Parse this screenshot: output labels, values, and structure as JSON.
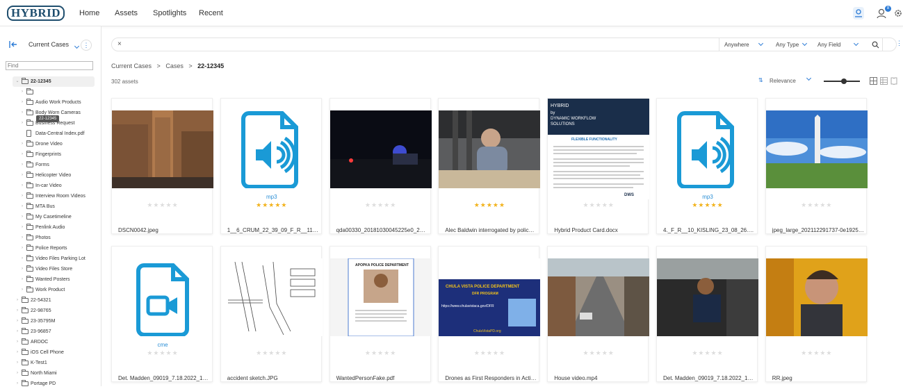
{
  "app": {
    "logo_text": "HYBRID"
  },
  "nav": [
    "Home",
    "Assets",
    "Spotlights",
    "Recent"
  ],
  "topbar": {
    "notification_count": "8"
  },
  "sidebar": {
    "case_select": "Current Cases",
    "find_placeholder": "Find",
    "tooltip": "22-12345",
    "tree": [
      {
        "label": "22-12345",
        "type": "folder",
        "level": 0,
        "open": true,
        "selected": true
      },
      {
        "label": "",
        "type": "folder",
        "level": 1
      },
      {
        "label": "Audio Work Products",
        "type": "folder",
        "level": 1
      },
      {
        "label": "Body Worn Cameras",
        "type": "folder",
        "level": 1
      },
      {
        "label": "Business Request",
        "type": "folder",
        "level": 1
      },
      {
        "label": "Data-Central Index.pdf",
        "type": "file",
        "level": 1
      },
      {
        "label": "Drone Video",
        "type": "folder",
        "level": 1
      },
      {
        "label": "Fingerprints",
        "type": "folder",
        "level": 1
      },
      {
        "label": "Forms",
        "type": "folder",
        "level": 1
      },
      {
        "label": "Helicopter Video",
        "type": "folder",
        "level": 1
      },
      {
        "label": "In-car Video",
        "type": "folder",
        "level": 1
      },
      {
        "label": "Interview Room Videos",
        "type": "folder",
        "level": 1
      },
      {
        "label": "MTA Bus",
        "type": "folder",
        "level": 1
      },
      {
        "label": "My Casetimeline",
        "type": "folder",
        "level": 1
      },
      {
        "label": "Penlink Audio",
        "type": "folder",
        "level": 1
      },
      {
        "label": "Photos",
        "type": "folder",
        "level": 1
      },
      {
        "label": "Police Reports",
        "type": "folder",
        "level": 1
      },
      {
        "label": "Video Files Parking Lot",
        "type": "folder",
        "level": 1
      },
      {
        "label": "Video Files Store",
        "type": "folder",
        "level": 1
      },
      {
        "label": "Wanted Posters",
        "type": "folder",
        "level": 1
      },
      {
        "label": "Work Product",
        "type": "folder",
        "level": 1
      },
      {
        "label": "22-54321",
        "type": "folder",
        "level": 0
      },
      {
        "label": "22-98765",
        "type": "folder",
        "level": 0
      },
      {
        "label": "23-35795M",
        "type": "folder",
        "level": 0
      },
      {
        "label": "23-96857",
        "type": "folder",
        "level": 0
      },
      {
        "label": "ARDOC",
        "type": "folder",
        "level": 0
      },
      {
        "label": "iOS Cell Phone",
        "type": "folder",
        "level": 0
      },
      {
        "label": "K-Test1",
        "type": "folder",
        "level": 0
      },
      {
        "label": "North Miami",
        "type": "folder",
        "level": 0
      },
      {
        "label": "Portage PD",
        "type": "folder",
        "level": 0
      }
    ]
  },
  "search": {
    "clear": "×",
    "scope": "Anywhere",
    "type": "Any Type",
    "field": "Any Field"
  },
  "breadcrumb": {
    "a": "Current Cases",
    "b": "Cases",
    "c": "22-12345",
    "sep": ">"
  },
  "results": {
    "count": "302 assets",
    "sort": "Relevance"
  },
  "colors": {
    "accent": "#2b7bd6",
    "icon_blue": "#1a9ad6",
    "star": "#f2b21b"
  },
  "cards": [
    {
      "name": "DSCN0042.jpeg",
      "thumb": "photo-street",
      "rating": 0,
      "ext": ""
    },
    {
      "name": "1__6_CRUM_22_39_09_F_R__11_CR...",
      "thumb": "audio-icon",
      "rating": 5,
      "ext": "mp3"
    },
    {
      "name": "qda00330_20181030045225e0_201...",
      "thumb": "photo-night",
      "rating": 0,
      "ext": ""
    },
    {
      "name": "Alec Baldwin interrogated by police ...",
      "thumb": "photo-interview",
      "rating": 5,
      "ext": ""
    },
    {
      "name": "Hybrid Product Card.docx",
      "thumb": "doc-card",
      "rating": 0,
      "ext": ""
    },
    {
      "name": "4._F_R__10_KISLING_23_08_26.mp3",
      "thumb": "audio-icon",
      "rating": 5,
      "ext": "mp3"
    },
    {
      "name": "jpeg_large_202112291737-0e19257...",
      "thumb": "photo-monument",
      "rating": 0,
      "ext": ""
    },
    {
      "name": "Det. Madden_09019_7.18.2022_103...",
      "thumb": "video-icon",
      "rating": 0,
      "ext": "cme"
    },
    {
      "name": "accident sketch.JPG",
      "thumb": "sketch",
      "rating": 0,
      "ext": ""
    },
    {
      "name": "WantedPersonFake.pdf",
      "thumb": "wanted",
      "rating": 0,
      "ext": ""
    },
    {
      "name": "Drones as First Responders in Actio...",
      "thumb": "dfr",
      "rating": 0,
      "ext": ""
    },
    {
      "name": "House video.mp4",
      "thumb": "photo-street2",
      "rating": 0,
      "ext": ""
    },
    {
      "name": "Det. Madden_09019_7.18.2022_103...",
      "thumb": "photo-bus",
      "rating": 0,
      "ext": ""
    },
    {
      "name": "RR.jpeg",
      "thumb": "photo-portrait",
      "rating": 0,
      "ext": ""
    }
  ],
  "doc_card": {
    "title": "HYBRID",
    "subtitle": "by DYNAMIC WORKFLOW SOLUTIONS",
    "heading": "FLEXIBLE FUNCTIONALITY",
    "brand": "DWS"
  },
  "wanted_card": {
    "title": "APOPKA POLICE DEPARTMENT"
  },
  "dfr_card": {
    "title": "CHULA VISTA POLICE DEPARTMENT",
    "program": "DFR PROGRAM",
    "url": "https://www.chulavistaca.gov/DFR",
    "site": "ChulaVistaPD.org"
  }
}
